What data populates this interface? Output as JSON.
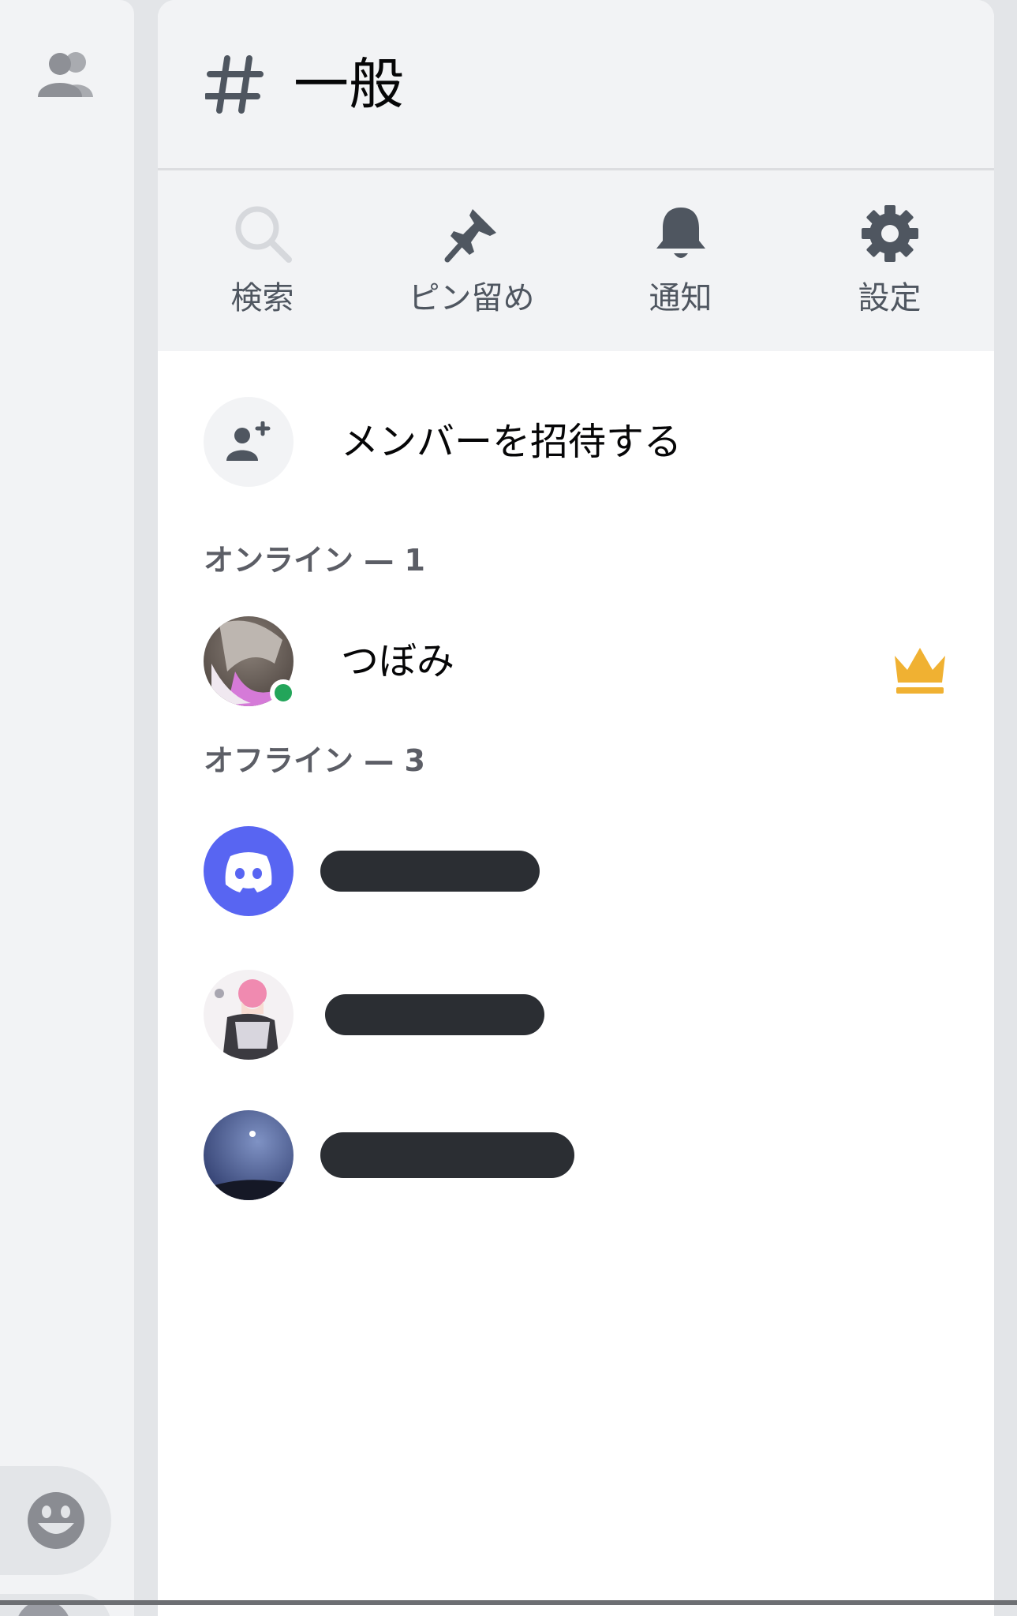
{
  "channel": {
    "name": "一般"
  },
  "actions": [
    {
      "label": "検索",
      "icon": "search-icon"
    },
    {
      "label": "ピン留め",
      "icon": "pin-icon"
    },
    {
      "label": "通知",
      "icon": "bell-icon"
    },
    {
      "label": "設定",
      "icon": "gear-icon"
    }
  ],
  "invite": {
    "label": "メンバーを招待する"
  },
  "sections": {
    "online_heading": "オンライン — 1",
    "offline_heading": "オフライン — 3"
  },
  "online_members": [
    {
      "name": "つぼみ",
      "status": "online",
      "owner": true
    }
  ],
  "offline_members_count": 3,
  "colors": {
    "online": "#23a55a",
    "crown": "#f0b132",
    "discord_blurple": "#5865f2",
    "redaction": "#2b2e33"
  }
}
